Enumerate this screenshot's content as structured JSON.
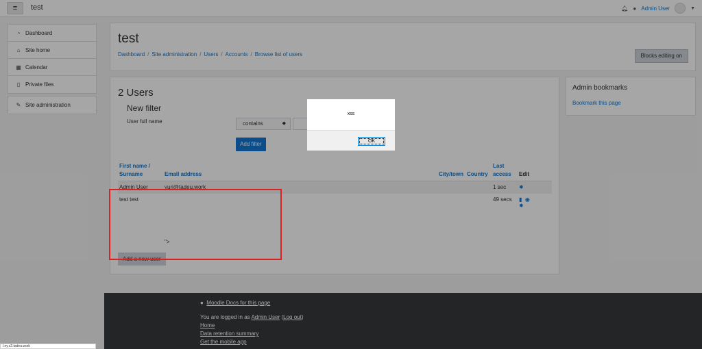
{
  "navbar": {
    "menu_icon": "hamburger-icon",
    "site_name": "test",
    "user_name": "Admin User"
  },
  "sidebar": {
    "group1": [
      {
        "label": "Dashboard",
        "icon": "dashboard-icon",
        "glyph": "◔"
      },
      {
        "label": "Site home",
        "icon": "home-icon",
        "glyph": "⌂"
      },
      {
        "label": "Calendar",
        "icon": "calendar-icon",
        "glyph": "▦"
      },
      {
        "label": "Private files",
        "icon": "file-icon",
        "glyph": "▯"
      }
    ],
    "group2": [
      {
        "label": "Site administration",
        "icon": "wrench-icon",
        "glyph": "✎"
      }
    ]
  },
  "header": {
    "title": "test",
    "breadcrumb": [
      "Dashboard",
      "Site administration",
      "Users",
      "Accounts",
      "Browse list of users"
    ],
    "blocks_button": "Blocks editing on"
  },
  "main": {
    "users_count": "2 Users",
    "new_filter": "New filter",
    "filter_label": "User full name",
    "filter_operator": "contains",
    "add_filter": "Add filter",
    "table": {
      "headers": {
        "name_line1": "First name /",
        "name_line2": "Surname",
        "email": "Email address",
        "city": "City/town",
        "country": "Country",
        "access_line1": "Last",
        "access_line2": "access",
        "edit": "Edit"
      },
      "rows": [
        {
          "name": "Admin User",
          "email": "yuri@tadeu.work",
          "city": "",
          "country": "",
          "last_access": "1 sec"
        },
        {
          "name": "test test",
          "email": "\">",
          "city": "",
          "country": "",
          "last_access": "49 secs"
        }
      ]
    },
    "add_user": "Add a new user"
  },
  "bookmarks": {
    "title": "Admin bookmarks",
    "link": "Bookmark this page"
  },
  "footer": {
    "docs_link": "Moodle Docs for this page",
    "logged_in_prefix": "You are logged in as ",
    "logged_in_user": "Admin User",
    "logout": "Log out",
    "home": "Home",
    "data_retention": "Data retention summary",
    "mobile_app": "Get the mobile app"
  },
  "status_bar": "l.ny.c2.tadeu.work",
  "alert": {
    "message": "xss",
    "ok": "OK"
  },
  "colors": {
    "link": "#1177d1",
    "overlay": "rgba(0,0,0,0.35)",
    "highlight_box": "#e02020",
    "footer_bg": "#373a3c"
  }
}
